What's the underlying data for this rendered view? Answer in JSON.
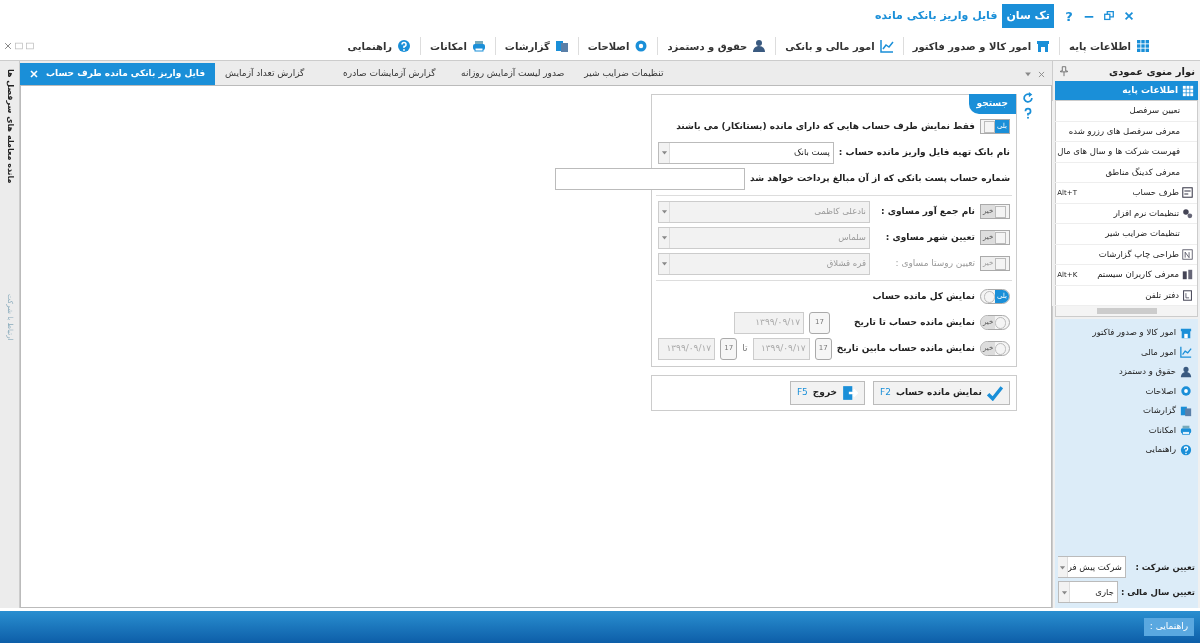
{
  "window": {
    "title": "فایل واریز بانکی مانده",
    "app_badge": "تک سان",
    "help": "?"
  },
  "menu": [
    {
      "label": "اطلاعات پایه"
    },
    {
      "label": "امور کالا و صدور فاکتور"
    },
    {
      "label": "امور مالی و بانکی"
    },
    {
      "label": "حقوق و دستمزد"
    },
    {
      "label": "اصلاحات"
    },
    {
      "label": "گزارشات"
    },
    {
      "label": "امکانات"
    },
    {
      "label": "راهنمایی"
    }
  ],
  "tabs": [
    {
      "label": "تنظیمات ضرایب شیر",
      "selected": false
    },
    {
      "label": "صدور لیست آزمایش روزانه",
      "selected": false
    },
    {
      "label": "گزارش آزمایشات صادره",
      "selected": false
    },
    {
      "label": "گزارش تعداد آزمایش",
      "selected": false
    },
    {
      "label": "فایل واریز بانکی مانده طرف حساب",
      "selected": true
    }
  ],
  "side_strip": {
    "label_1": "مانده معامله های سرفصل ها",
    "label_2": "ارتباط با شرکت"
  },
  "search_panel": {
    "title": "جستجو",
    "sections": [
      [
        {
          "kind": "toggle_text",
          "toggle": {
            "kind": "square",
            "label": "بلی",
            "on": true,
            "disabled": false
          },
          "label": "فقط نمایش طرف حساب هایی که دارای مانده (بستانکار) می باشند"
        },
        {
          "kind": "combo",
          "label": "نام بانک تهیه فایل واریز مانده حساب :",
          "value": "پست بانک",
          "disabled": false
        },
        {
          "kind": "input",
          "label": "شماره حساب پست بانکی که از آن مبالغ پرداخت خواهد شد"
        }
      ],
      [
        {
          "kind": "toggle_combo",
          "toggle": {
            "kind": "square",
            "label": "خیر",
            "on": false,
            "disabled": false
          },
          "label": "نام جمع آور مساوی :",
          "value": "نادعلی کاظمی",
          "disabled": true
        },
        {
          "kind": "toggle_combo",
          "toggle": {
            "kind": "square",
            "label": "خیر",
            "on": false,
            "disabled": false
          },
          "label": "تعیین شهر مساوی :",
          "value": "سلماس",
          "disabled": true
        },
        {
          "kind": "toggle_combo",
          "toggle": {
            "kind": "square",
            "label": "خیر",
            "on": false,
            "disabled": true
          },
          "label": "تعیین روستا مساوی :",
          "value": "قره قشلاق",
          "disabled": true
        }
      ],
      [
        {
          "kind": "toggle_text",
          "toggle": {
            "kind": "round",
            "label": "بلی",
            "on": true,
            "disabled": false
          },
          "label": "نمایش کل مانده حساب"
        },
        {
          "kind": "toggle_dates",
          "toggle": {
            "kind": "round",
            "label": "خیر",
            "on": false,
            "disabled": false
          },
          "label": "نمایش مانده حساب تا تاریخ",
          "dates": [
            {
              "calendar": "17",
              "value": "۱۳۹۹/۰۹/۱۷"
            }
          ]
        },
        {
          "kind": "toggle_dates",
          "toggle": {
            "kind": "round",
            "label": "خیر",
            "on": false,
            "disabled": false
          },
          "label": "نمایش مانده حساب مابین تاریخ",
          "dates": [
            {
              "calendar": "17",
              "value": "۱۳۹۹/۰۹/۱۷"
            },
            {
              "calendar": "17",
              "value": "۱۳۹۹/۰۹/۱۷"
            }
          ],
          "separator": "تا"
        }
      ]
    ]
  },
  "buttons": [
    {
      "kind": "confirm",
      "label": "نمایش مانده حساب",
      "key": "F2"
    },
    {
      "kind": "exit",
      "label": "خروج",
      "key": "F5"
    }
  ],
  "sidebar": {
    "title": "نوار منوی عمودی",
    "groups": [
      {
        "label": "اطلاعات پایه",
        "expanded": true,
        "children": [
          {
            "label": "تعیین سرفصل"
          },
          {
            "label": "معرفی سرفصل های رزرو شده"
          },
          {
            "label": "فهرست شرکت ها و سال های مال"
          },
          {
            "label": "معرفی کدینگ مناطق"
          },
          {
            "label": "طرف حساب",
            "shortcut": "Alt+T"
          },
          {
            "label": "تنظیمات نرم افزار"
          },
          {
            "label": "تنظیمات ضرایب شیر"
          },
          {
            "label": "طراحی چاپ گزارشات"
          },
          {
            "label": "معرفی کاربران سیستم",
            "shortcut": "Alt+K"
          },
          {
            "label": "دفتر تلفن"
          }
        ]
      },
      {
        "label": "امور کالا و صدور فاکتور",
        "expanded": false
      },
      {
        "label": "امور مالی",
        "expanded": false
      },
      {
        "label": "حقوق و دستمزد",
        "expanded": false
      },
      {
        "label": "اصلاحات",
        "expanded": false
      },
      {
        "label": "گزارشات",
        "expanded": false
      },
      {
        "label": "امکانات",
        "expanded": false
      },
      {
        "label": "راهنمایی",
        "expanded": false
      }
    ],
    "company": {
      "label": "تعیین شرکت :",
      "value": "شرکت پیش فر"
    },
    "fiscal_year": {
      "label": "تعیین سال مالی :",
      "value": "جاری"
    }
  },
  "status_bar": {
    "label": "راهنمایی :"
  }
}
